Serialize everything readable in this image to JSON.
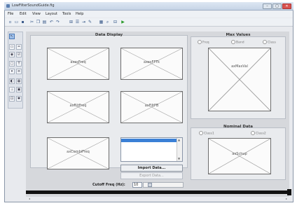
{
  "window": {
    "title": "LowFilterSoundGuide.fig",
    "controls": [
      "–",
      "▢",
      "✕"
    ]
  },
  "menu": [
    "File",
    "Edit",
    "View",
    "Layout",
    "Tools",
    "Help"
  ],
  "toolbar_icons": [
    "new-icon",
    "open-icon",
    "save-icon",
    "cut-icon",
    "copy-icon",
    "paste-icon",
    "undo-icon",
    "redo-icon",
    "align-icon",
    "menu-editor-icon",
    "tab-order-icon",
    "mfile-editor-icon",
    "property-inspector-icon",
    "object-browser-icon",
    "run-icon"
  ],
  "palette_icons": [
    "select-icon",
    "pushbutton-icon",
    "slider-icon",
    "radiobutton-icon",
    "checkbox-icon",
    "edittext-icon",
    "statictext-icon",
    "popupmenu-icon",
    "listbox-icon",
    "togglebutton-icon",
    "table-icon",
    "axes-icon",
    "panel-icon",
    "buttongroup-icon",
    "activex-icon"
  ],
  "panels": {
    "data_display": {
      "title": "Data Display",
      "axes": [
        "axesFreq",
        "axesFFTk",
        "axFiltFreq",
        "axFiltFB",
        "axCombiFreq"
      ]
    },
    "max_values": {
      "title": "Max Values",
      "radios": [
        "Freq",
        "Band",
        "Class"
      ],
      "axes": "axMaxVal"
    },
    "nominal_data": {
      "title": "Nominal Data",
      "radios": [
        "Class1",
        "Class2"
      ],
      "axes": "axSchup"
    }
  },
  "controls": {
    "import_button": "Import Data...",
    "export_button": "Export Data...",
    "cutoff_label": "Cutoff Freq (Hz):",
    "cutoff_value": "10"
  },
  "colors": {
    "selection": "#3b80d6",
    "titlebar": "#c6d4e6"
  }
}
